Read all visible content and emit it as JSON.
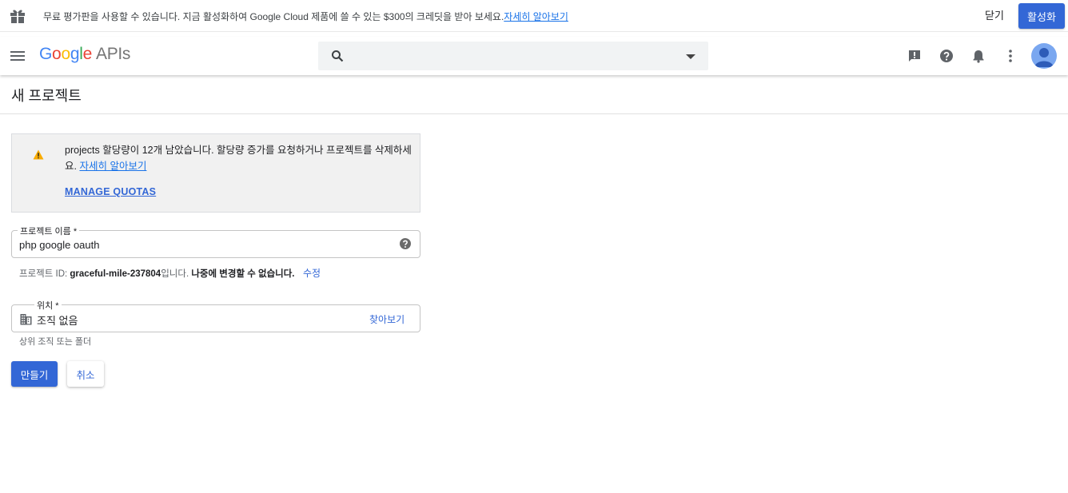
{
  "promo": {
    "message": "무료 평가판을 사용할 수 있습니다. 지금 활성화하여 Google Cloud 제품에 쓸 수 있는 $300의 크레딧을 받아 보세요.",
    "learn_more": "자세히 알아보기",
    "dismiss_label": "닫기",
    "activate_label": "활성화"
  },
  "header": {
    "logo_letters": [
      "G",
      "o",
      "o",
      "g",
      "l",
      "e"
    ],
    "logo_suffix": "APIs",
    "search": {
      "placeholder": "",
      "value": ""
    },
    "icons": [
      "feedback-icon",
      "help-icon",
      "notifications-icon",
      "more-vert-icon",
      "account-avatar"
    ]
  },
  "page": {
    "title": "새 프로젝트"
  },
  "quota_warning": {
    "text": "projects 할당량이 12개 남았습니다. 할당량 증가를 요청하거나 프로젝트를 삭제하세요.",
    "learn_more": "자세히 알아보기",
    "manage_label": "MANAGE QUOTAS"
  },
  "project_name": {
    "label": "프로젝트 이름 *",
    "value": "php google oauth"
  },
  "project_id": {
    "prefix": "프로젝트 ID: ",
    "id": "graceful-mile-237804",
    "suffix": "입니다. ",
    "note": "나중에 변경할 수 없습니다.",
    "edit_label": "수정"
  },
  "location": {
    "label": "위치 *",
    "value": "조직 없음",
    "browse_label": "찾아보기",
    "hint": "상위 조직 또는 폴더"
  },
  "actions": {
    "create_label": "만들기",
    "cancel_label": "취소"
  },
  "colors": {
    "primary": "#3367d6",
    "link": "#1a73e8",
    "warning": "#f9ab00"
  }
}
